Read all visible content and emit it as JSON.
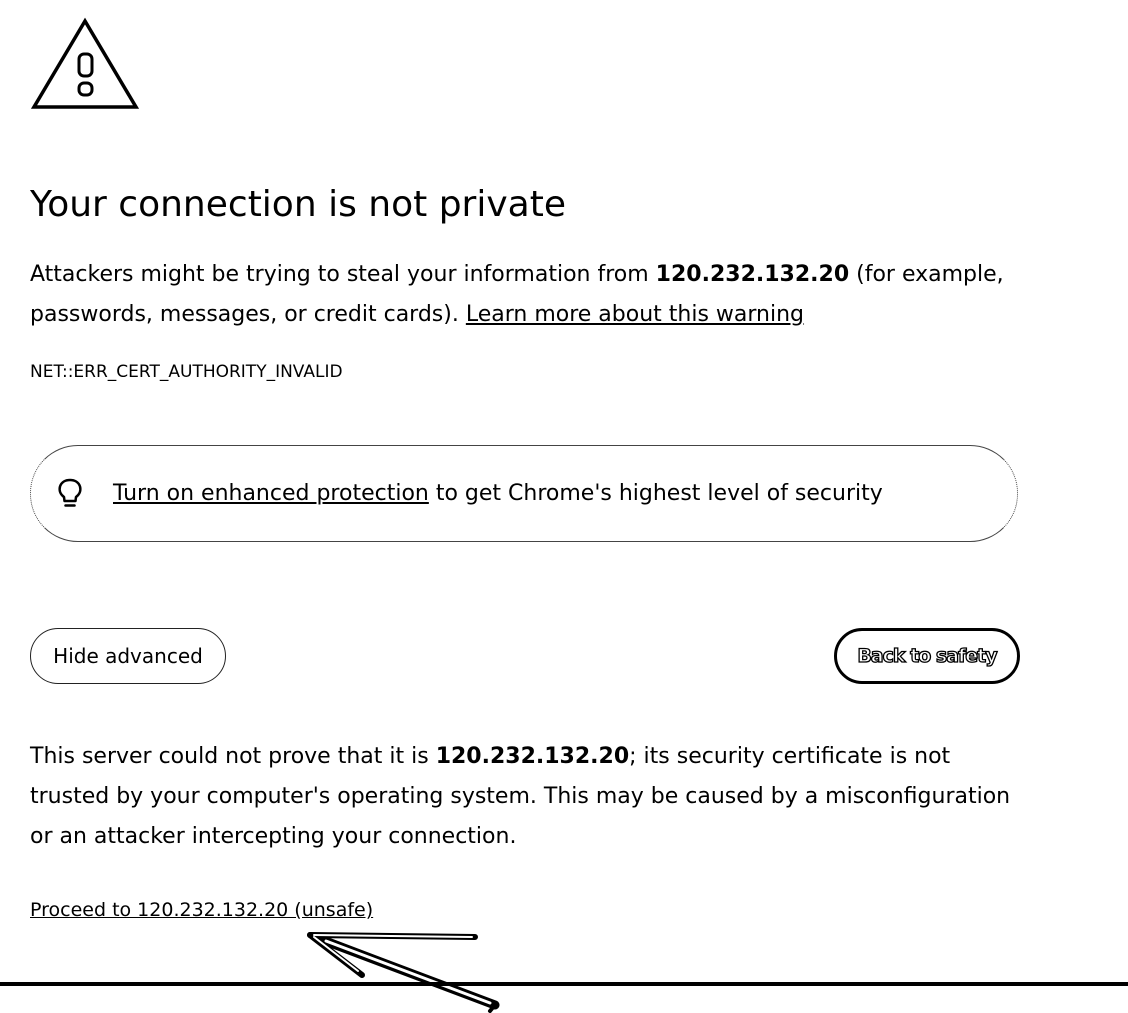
{
  "page": {
    "title": "Your connection is not private",
    "intro_before_host": "Attackers might be trying to steal your information from ",
    "host": "120.232.132.20",
    "intro_after_host": " (for example, passwords, messages, or credit cards). ",
    "learn_more_link": "Learn more about this warning",
    "error_code": "NET::ERR_CERT_AUTHORITY_INVALID"
  },
  "promo": {
    "icon": "lightbulb-icon",
    "link_text": "Turn on enhanced protection",
    "rest_text": " to get Chrome's highest level of security"
  },
  "buttons": {
    "hide_advanced": "Hide advanced",
    "back_to_safety": "Back to safety"
  },
  "details": {
    "before_host": "This server could not prove that it is ",
    "host": "120.232.132.20",
    "after_host": "; its security certificate is not trusted by your computer's operating system. This may be caused by a misconfiguration or an attacker intercepting your connection."
  },
  "proceed_link": "Proceed to 120.232.132.20 (unsafe)",
  "icons": {
    "warning": "warning-triangle-icon",
    "cursor": "mouse-pointer-icon"
  }
}
